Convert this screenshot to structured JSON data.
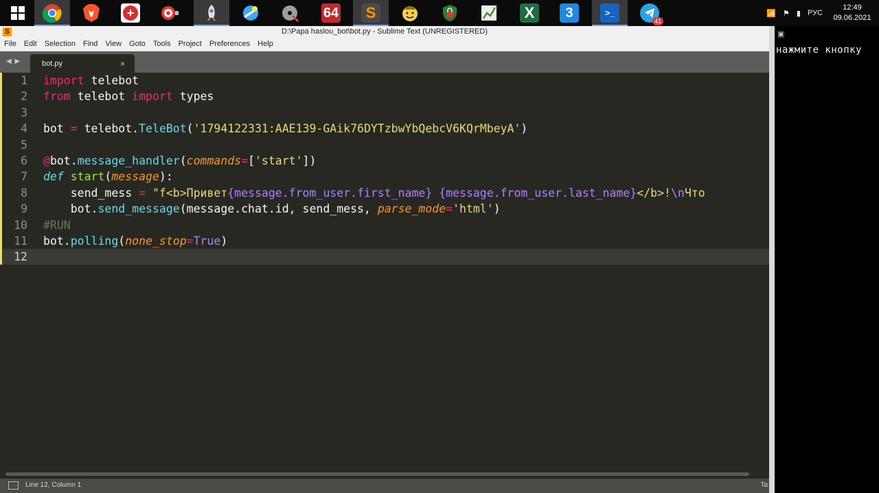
{
  "taskbar": {
    "items": [
      {
        "name": "windows-start-icon",
        "glyph": "",
        "color": "#0b0b0b"
      },
      {
        "name": "chrome-icon",
        "glyph": "",
        "color": "#e0463a"
      },
      {
        "name": "brave-icon",
        "glyph": "",
        "color": "#fb542b"
      },
      {
        "name": "transcend-icon",
        "glyph": "+",
        "color": "#d32f2f"
      },
      {
        "name": "target-app-icon",
        "glyph": "",
        "color": "#e53935"
      },
      {
        "name": "python-rocket-icon",
        "glyph": "",
        "color": "#4b7bbd"
      },
      {
        "name": "network-tool-icon",
        "glyph": "",
        "color": "#3fa9f5"
      },
      {
        "name": "cd-player-icon",
        "glyph": "",
        "color": "#9e9e9e"
      },
      {
        "name": "app-64-icon",
        "glyph": "64",
        "color": "#c62828"
      },
      {
        "name": "sublime-text-icon",
        "glyph": "S",
        "color": "#ff9800"
      },
      {
        "name": "vault-boy-icon",
        "glyph": "",
        "color": "#f5d04a"
      },
      {
        "name": "shield-lock-icon",
        "glyph": "",
        "color": "#2e7d32"
      },
      {
        "name": "chart-app-icon",
        "glyph": "",
        "color": "#558b2f"
      },
      {
        "name": "excel-icon",
        "glyph": "X",
        "color": "#1d6f42"
      },
      {
        "name": "app-3-icon",
        "glyph": "3",
        "color": "#1e88e5"
      },
      {
        "name": "powershell-icon",
        "glyph": ">_",
        "color": "#1565c0"
      },
      {
        "name": "telegram-icon",
        "glyph": "",
        "color": "#2aa3e0",
        "badge": "41"
      }
    ],
    "tray": {
      "signal": "📶",
      "flag": "⚑",
      "power": "▮",
      "lang": "РУС",
      "time": "12:49",
      "date": "09.06.2021"
    }
  },
  "window": {
    "title": "D:\\Papa haslou_bot\\bot.py - Sublime Text (UNREGISTERED)",
    "menu": [
      "File",
      "Edit",
      "Selection",
      "Find",
      "View",
      "Goto",
      "Tools",
      "Project",
      "Preferences",
      "Help"
    ],
    "tab_nav": "◀ ▶",
    "tab": {
      "label": "bot.py",
      "close": "×"
    },
    "status_left": "Line 12, Column 1",
    "status_right": "Ta"
  },
  "editor": {
    "line_numbers": [
      "1",
      "2",
      "3",
      "4",
      "5",
      "6",
      "7",
      "8",
      "9",
      "10",
      "11",
      "12"
    ],
    "current_line": "12",
    "lines": [
      {
        "import": "import",
        "mod": " telebot"
      },
      {
        "from": "from",
        "mod": " telebot ",
        "import": "import",
        "name": " types"
      },
      {},
      {
        "var": "bot",
        "eq": " = ",
        "obj": "telebot.",
        "cls": "TeleBot",
        "open": "(",
        "str": "'1794122331:AAE139-GAik76DYTzbwYbQebcV6KQrMbeyA'",
        "close": ")"
      },
      {},
      {
        "at": "@",
        "obj": "bot.",
        "fn": "message_handler",
        "open": "(",
        "arg": "commands",
        "eq": "=",
        "lb": "[",
        "str": "'start'",
        "rb": "])"
      },
      {
        "def": "def",
        "sp": " ",
        "fn": "start",
        "open": "(",
        "arg": "message",
        "close": "):"
      },
      {
        "indent": "    ",
        "var": "send_mess",
        "eq": " = ",
        "str1": "\"f<b>Привет",
        "i1": "{message.from_user.first_name}",
        "str2": " ",
        "i2": "{message.from_user.last_name}",
        "str3": "</b>!",
        "esc": "\\n",
        "str4": "Что"
      },
      {
        "indent": "    ",
        "obj": "bot.",
        "fn": "send_message",
        "args": "(message.chat.id, send_mess, ",
        "arg": "parse_mode",
        "eq": "=",
        "str": "'html'",
        "close": ")"
      },
      {
        "comment": "#RUN"
      },
      {
        "obj": "bot.",
        "fn": "polling",
        "open": "(",
        "arg": "none_stop",
        "eq": "=",
        "const": "True",
        "close": ")"
      },
      {}
    ]
  },
  "console": {
    "icon": "▣",
    "text": "нажмите кнопку"
  }
}
